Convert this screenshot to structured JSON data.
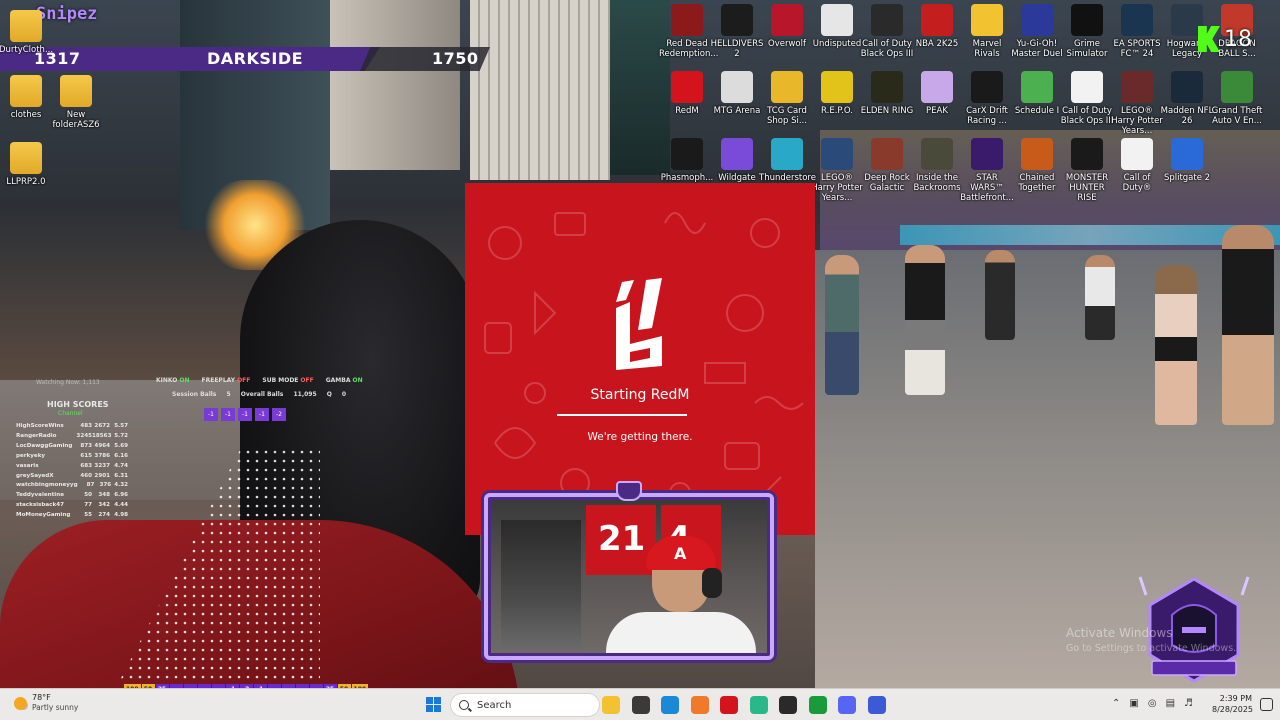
{
  "overlay": {
    "streamer": "Snipez",
    "score_left": "1317",
    "team": "DARKSIDE",
    "score_right": "1750"
  },
  "desktop_left": [
    {
      "label": "DurtyCloth..."
    },
    {
      "label": "clothes"
    },
    {
      "label": "New folderASZ6"
    },
    {
      "label": "LLPRP2.0"
    }
  ],
  "desktop_right": [
    {
      "label": "Red Dead Redemption...",
      "color": "#8c1a1a"
    },
    {
      "label": "HELLDIVERS 2",
      "color": "#1c1c1c"
    },
    {
      "label": "Overwolf",
      "color": "#b8162a"
    },
    {
      "label": "Undisputed",
      "color": "#e6e6e6"
    },
    {
      "label": "Call of Duty Black Ops III",
      "color": "#2a2a2a"
    },
    {
      "label": "NBA 2K25",
      "color": "#c41e1e"
    },
    {
      "label": "Marvel Rivals",
      "color": "#f2c230"
    },
    {
      "label": "Yu-Gi-Oh! Master Duel",
      "color": "#2b3a9a"
    },
    {
      "label": "Grime Simulator",
      "color": "#111111"
    },
    {
      "label": "EA SPORTS FC™ 24",
      "color": "#1a3550"
    },
    {
      "label": "Hogwarts Legacy",
      "color": "#2b3a4a"
    },
    {
      "label": "DRAGON BALL S...",
      "color": "#c0392b"
    },
    {
      "label": "RedM",
      "color": "#d3141c"
    },
    {
      "label": "MTG Arena",
      "color": "#dcdcdc"
    },
    {
      "label": "TCG Card Shop Si...",
      "color": "#e8b82a"
    },
    {
      "label": "R.E.P.O.",
      "color": "#e1c31a"
    },
    {
      "label": "ELDEN RING",
      "color": "#2a2a1a"
    },
    {
      "label": "PEAK",
      "color": "#c8a8e8"
    },
    {
      "label": "CarX Drift Racing ...",
      "color": "#1a1a1a"
    },
    {
      "label": "Schedule I",
      "color": "#4caf50"
    },
    {
      "label": "Call of Duty Black Ops III",
      "color": "#f2f2f2"
    },
    {
      "label": "LEGO® Harry Potter Years...",
      "color": "#6a2a2a"
    },
    {
      "label": "Madden NFL 26",
      "color": "#1a2a3a"
    },
    {
      "label": "Grand Theft Auto V En...",
      "color": "#3a8a3a"
    },
    {
      "label": "Phasmoph...",
      "color": "#1a1a1a"
    },
    {
      "label": "Wildgate",
      "color": "#7a4ad8"
    },
    {
      "label": "Thunderstore Mod Mana...",
      "color": "#2aa8c8"
    },
    {
      "label": "LEGO® Harry Potter Years...",
      "color": "#2a4a7a"
    },
    {
      "label": "Deep Rock Galactic",
      "color": "#8a3a2a"
    },
    {
      "label": "Inside the Backrooms",
      "color": "#4a4a3a"
    },
    {
      "label": "STAR WARS™ Battlefront...",
      "color": "#3a1a6a"
    },
    {
      "label": "Chained Together",
      "color": "#c85a1a"
    },
    {
      "label": "MONSTER HUNTER RISE",
      "color": "#1a1a1a"
    },
    {
      "label": "Call of Duty®",
      "color": "#f2f2f2"
    },
    {
      "label": "Splitgate 2",
      "color": "#2a6ad8"
    }
  ],
  "kick": {
    "count": "18"
  },
  "plinko": {
    "watching": "Watching Now: 1,113",
    "status": [
      {
        "label": "KINKO",
        "state": "ON",
        "on": true
      },
      {
        "label": "FREEPLAY",
        "state": "OFF",
        "on": false
      },
      {
        "label": "SUB MODE",
        "state": "OFF",
        "on": false
      },
      {
        "label": "GAMBA",
        "state": "ON",
        "on": true
      }
    ],
    "session_balls_label": "Session Balls",
    "session_balls": "5",
    "overall_balls_label": "Overall Balls",
    "overall_balls": "11,095",
    "q_label": "Q",
    "q_value": "0",
    "slots": [
      "-1",
      "-1",
      "-1",
      "-1",
      "-2"
    ],
    "hs_title": "HIGH SCORES",
    "hs_sub": "Channel",
    "high_scores": [
      {
        "name": "HighScoreWins",
        "a": "483",
        "b": "2672",
        "c": "5.57"
      },
      {
        "name": "RangerRadio",
        "a": "3245",
        "b": "18563",
        "c": "5.72"
      },
      {
        "name": "LocDawggGaming",
        "a": "873",
        "b": "4964",
        "c": "5.69"
      },
      {
        "name": "perkyeky",
        "a": "615",
        "b": "3786",
        "c": "6.16"
      },
      {
        "name": "vasaris",
        "a": "683",
        "b": "3237",
        "c": "4.74"
      },
      {
        "name": "greySayedX",
        "a": "460",
        "b": "2901",
        "c": "6.31"
      },
      {
        "name": "watchbingmoneyyg",
        "a": "87",
        "b": "376",
        "c": "4.32"
      },
      {
        "name": "Teddyvalentine",
        "a": "50",
        "b": "348",
        "c": "6.96"
      },
      {
        "name": "stacksisback47",
        "a": "77",
        "b": "342",
        "c": "4.44"
      },
      {
        "name": "MoMoneyGaming",
        "a": "55",
        "b": "274",
        "c": "4.98"
      }
    ],
    "multipliers": [
      "100",
      "50",
      "35",
      "",
      "",
      "",
      "",
      "-1",
      "-2",
      "-1",
      "",
      "",
      "",
      "",
      "35",
      "50",
      "100"
    ]
  },
  "splash": {
    "title": "Starting RedM",
    "subtitle": "We're getting there."
  },
  "cam": {
    "num1": "21",
    "num2": "4"
  },
  "watermark": {
    "line1": "Activate Windows",
    "line2": "Go to Settings to activate Windows."
  },
  "taskbar": {
    "temp": "78°F",
    "condition": "Partly sunny",
    "search_placeholder": "Search",
    "time": "2:39 PM",
    "date": "8/28/2025",
    "apps": [
      {
        "name": "file-explorer-icon",
        "color": "#f2c230"
      },
      {
        "name": "taskview-icon",
        "color": "#3a3a3a"
      },
      {
        "name": "edge-icon",
        "color": "#1a8ad8"
      },
      {
        "name": "overwolf-icon",
        "color": "#f07a2a"
      },
      {
        "name": "redm-icon",
        "color": "#d3141c"
      },
      {
        "name": "greenapp-icon",
        "color": "#2ab88a"
      },
      {
        "name": "obs-icon",
        "color": "#2a2a2a"
      },
      {
        "name": "xbox-icon",
        "color": "#1a9a3a"
      },
      {
        "name": "discord-icon",
        "color": "#5865f2"
      },
      {
        "name": "app-icon",
        "color": "#3a5ad8"
      }
    ]
  }
}
